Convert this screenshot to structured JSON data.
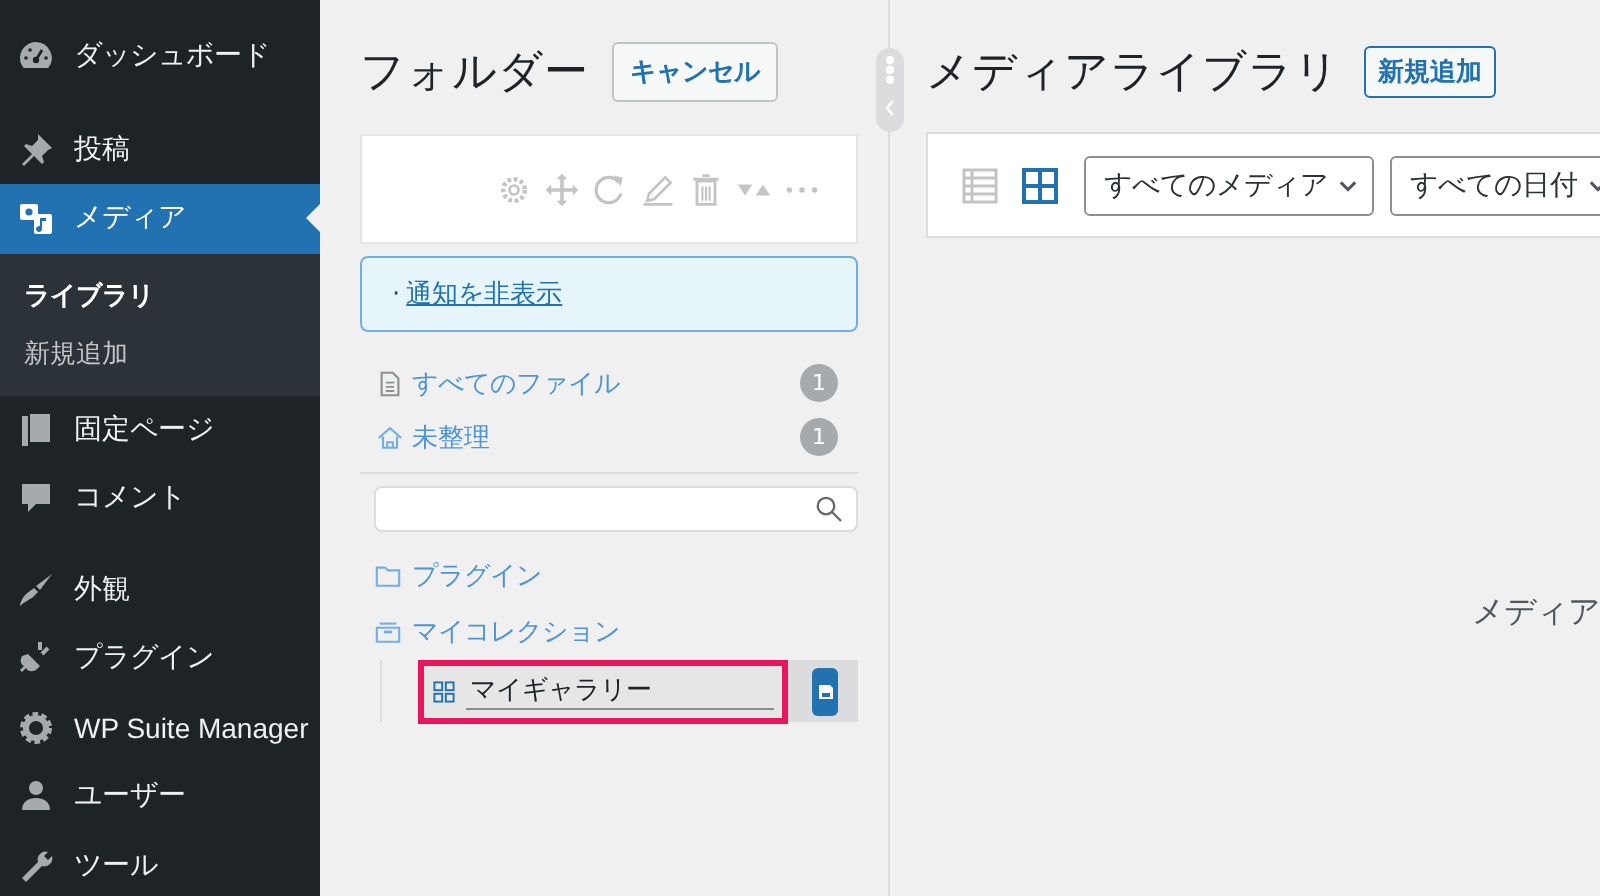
{
  "sidebar": {
    "items": [
      {
        "label": "ダッシュボード",
        "selected": false
      },
      {
        "label": "投稿",
        "selected": false
      },
      {
        "label": "メディア",
        "selected": true,
        "children": [
          {
            "label": "ライブラリ",
            "selected": true
          },
          {
            "label": "新規追加",
            "selected": false
          }
        ]
      },
      {
        "label": "固定ページ",
        "selected": false
      },
      {
        "label": "コメント",
        "selected": false
      },
      {
        "label": "外観",
        "selected": false
      },
      {
        "label": "プラグイン",
        "selected": false
      },
      {
        "label": "WP Suite Manager",
        "selected": false
      },
      {
        "label": "ユーザー",
        "selected": false
      },
      {
        "label": "ツール",
        "selected": false
      }
    ]
  },
  "folder_panel": {
    "title": "フォルダー",
    "cancel_button": "キャンセル",
    "notice": {
      "bullet": "·",
      "link": "通知を非表示"
    },
    "special_folders": [
      {
        "label": "すべてのファイル",
        "count": "1"
      },
      {
        "label": "未整理",
        "count": "1"
      }
    ],
    "folders": [
      {
        "kind": "folder",
        "label": "プラグイン"
      },
      {
        "kind": "collection",
        "label": "マイコレクション",
        "children": [
          {
            "kind": "gallery",
            "label": "マイギャラリー",
            "editing": true
          }
        ]
      }
    ]
  },
  "main": {
    "title": "メディアライブラリ",
    "add_button": "新規追加",
    "view_modes": [
      {
        "kind": "list",
        "selected": false
      },
      {
        "kind": "grid",
        "selected": true
      }
    ],
    "filters": [
      "すべてのメディア",
      "すべての日付"
    ],
    "empty_text": "メディア"
  }
}
